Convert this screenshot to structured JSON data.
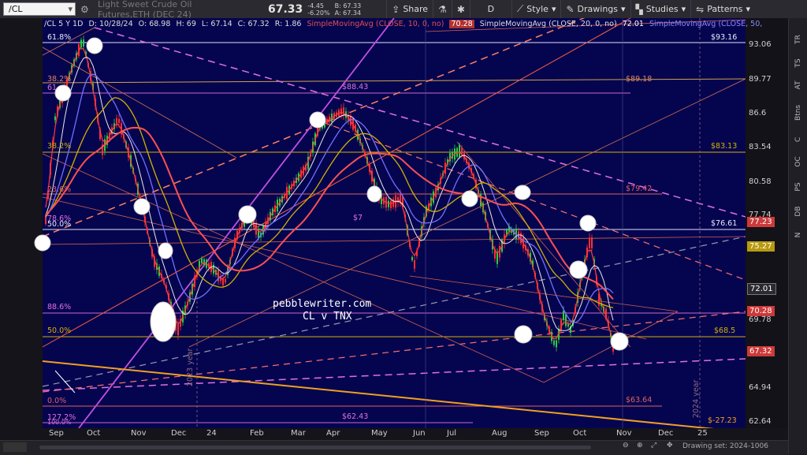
{
  "toolbar": {
    "symbol": "/CL",
    "description": "Light Sweet Crude Oil Futures,ETH (DEC 24)",
    "last_price": "67.33",
    "change": "-4.45",
    "change_pct": "-6.20%",
    "bid": "B: 67.33",
    "ask": "A: 67.34",
    "share_label": "Share",
    "period_label": "D",
    "style_label": "Style",
    "drawings_label": "Drawings",
    "studies_label": "Studies",
    "patterns_label": "Patterns"
  },
  "info_line": {
    "symbol": "/CL 5 Y 1D",
    "date": "D: 10/28/24",
    "open": "O: 68.98",
    "high": "H: 69",
    "low": "L: 67.14",
    "close": "C: 67.32",
    "range": "R: 1.86",
    "sma10": "SimpleMovingAvg (CLOSE, 10, 0, no)",
    "sma10_val": "70.28",
    "sma20": "SimpleMovingAvg (CLOSE, 20, 0, no)",
    "sma20_val": "72.01",
    "sma50": "SimpleMovingAvg (CLOSE, 50,"
  },
  "price_axis": [
    "93.06",
    "89.77",
    "86.6",
    "83.54",
    "80.58",
    "77.74",
    "75.27",
    "72.01",
    "69.78",
    "67.32",
    "64.94",
    "62.64"
  ],
  "price_badges": [
    {
      "text": "77.23",
      "color": "#cc3a3a"
    },
    {
      "text": "75.27",
      "color": "#b89a10"
    },
    {
      "text": "72.01",
      "color": "#2a2a30"
    },
    {
      "text": "70.28",
      "color": "#cc3a3a"
    },
    {
      "text": "67.32",
      "color": "#cc3a3a"
    }
  ],
  "time_axis": [
    "Sep",
    "Oct",
    "Nov",
    "Dec",
    "24",
    "Feb",
    "Mar",
    "Apr",
    "May",
    "Jun",
    "Jul",
    "Aug",
    "Sep",
    "Oct",
    "Nov",
    "Dec",
    "25"
  ],
  "fib_labels": {
    "f618": "61.8%",
    "f382a": "38.2%",
    "f61": "61",
    "f382b": "38.2%",
    "f236": "23.6%",
    "f786": "78.6%",
    "f50a": "50.0%",
    "f886": "88.6%",
    "f50b": "50.0%",
    "f00": "0.0%",
    "f1272": "127.2%",
    "f1000": "100.0%"
  },
  "level_labels": {
    "l9316": "$93.16",
    "l8843": "$88.43",
    "l8918": "$89.18",
    "l8313": "$83.13",
    "l7942": "$79.42",
    "l7661": "$76.61",
    "l77": "$7",
    "l685": "$68.5",
    "l6364": "$63.64",
    "l6243": "$62.43",
    "lneg": "$-27.23"
  },
  "watermark": {
    "line1": "pebblewriter.com",
    "line2": "CL v TNX"
  },
  "vertical_labels": {
    "y2023": "2023 year",
    "y2024": "2024 year"
  },
  "side_tabs": [
    "TR",
    "TS",
    "AT",
    "Btns",
    "C",
    "OC",
    "PS",
    "DB",
    "N"
  ],
  "status": "Drawing set: 2024-1006"
}
